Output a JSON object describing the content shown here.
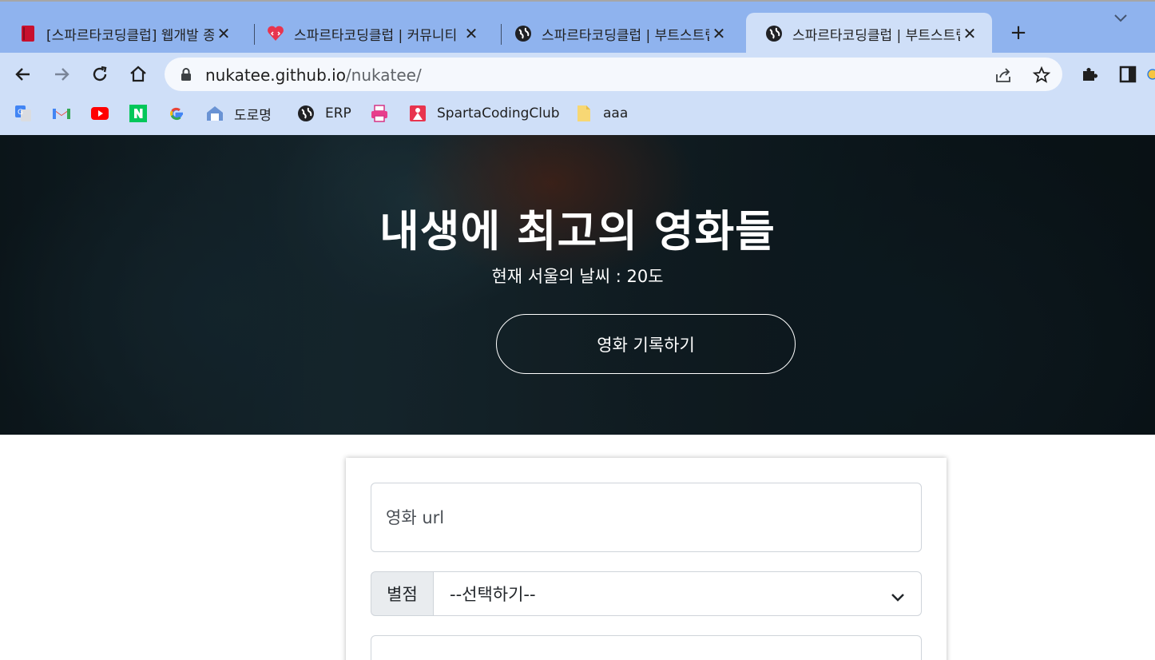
{
  "browser": {
    "tabs": [
      {
        "title": "[스파르타코딩클럽] 웹개발 종합반",
        "favicon": "book-icon",
        "active": false
      },
      {
        "title": "스파르타코딩클럽 | 커뮤니티",
        "favicon": "code-heart-icon",
        "active": false
      },
      {
        "title": "스파르타코딩클럽 | 부트스트랩",
        "favicon": "globe-icon",
        "active": false
      },
      {
        "title": "스파르타코딩클럽 | 부트스트랩",
        "favicon": "globe-icon",
        "active": true
      }
    ],
    "new_tab_label": "+",
    "close_glyph": "✕",
    "address": {
      "host": "nukatee.github.io",
      "path": "/nukatee/"
    },
    "bookmarks": [
      {
        "label": "",
        "icon": "google-translate-icon"
      },
      {
        "label": "",
        "icon": "gmail-icon"
      },
      {
        "label": "",
        "icon": "youtube-icon"
      },
      {
        "label": "",
        "icon": "naver-icon"
      },
      {
        "label": "",
        "icon": "google-icon"
      },
      {
        "label": "도로명",
        "icon": "house-icon"
      },
      {
        "label": "ERP",
        "icon": "globe-icon"
      },
      {
        "label": "",
        "icon": "printer-icon"
      },
      {
        "label": "SpartaCodingClub",
        "icon": "sparta-icon"
      },
      {
        "label": "aaa",
        "icon": "folder-icon"
      }
    ]
  },
  "hero": {
    "title": "내생에 최고의 영화들",
    "weather": "현재 서울의 날씨 : 20도",
    "button_label": "영화 기록하기"
  },
  "form": {
    "url_placeholder": "영화 url",
    "rating_label": "별점",
    "rating_selected": "--선택하기--"
  },
  "colors": {
    "tabstrip": "#8fb3ee",
    "toolbar": "#cfdff8",
    "youtube": "#ff0000",
    "naver": "#03c75a",
    "sparta": "#e8344e"
  }
}
